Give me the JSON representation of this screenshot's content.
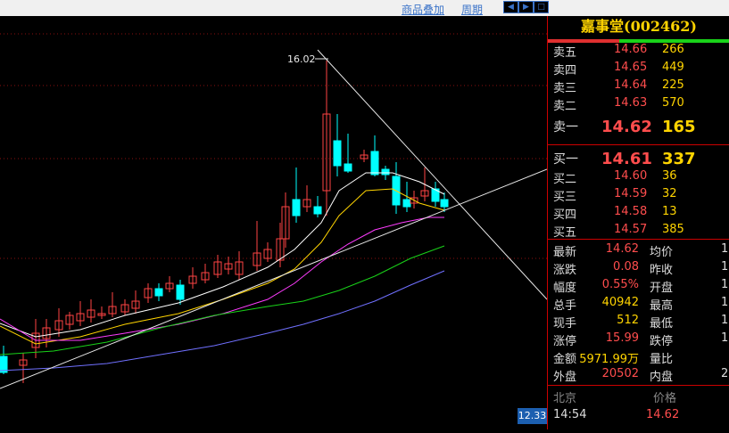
{
  "toolbar": {
    "overlay_label": "商品叠加",
    "period_label": "周期"
  },
  "chart_data": {
    "type": "candlestick",
    "title": "",
    "peak_annotation": "16.02",
    "current_price_tag": "12.33",
    "ma_colors": [
      "#ffffff",
      "#ffd400",
      "#ff3cff",
      "#19d219",
      "#7070ff"
    ],
    "up_color": "#ff4444",
    "down_color": "#00ffff"
  },
  "quote": {
    "title": "嘉事堂(002462)",
    "asks": [
      {
        "label": "卖五",
        "price": "14.66",
        "vol": "266"
      },
      {
        "label": "卖四",
        "price": "14.65",
        "vol": "449"
      },
      {
        "label": "卖三",
        "price": "14.64",
        "vol": "225"
      },
      {
        "label": "卖二",
        "price": "14.63",
        "vol": "570"
      },
      {
        "label": "卖一",
        "price": "14.62",
        "vol": "165"
      }
    ],
    "bids": [
      {
        "label": "买一",
        "price": "14.61",
        "vol": "337"
      },
      {
        "label": "买二",
        "price": "14.60",
        "vol": "36"
      },
      {
        "label": "买三",
        "price": "14.59",
        "vol": "32"
      },
      {
        "label": "买四",
        "price": "14.58",
        "vol": "13"
      },
      {
        "label": "买五",
        "price": "14.57",
        "vol": "385"
      }
    ],
    "stats": [
      {
        "l1": "最新",
        "v1": "14.62",
        "c1": "red",
        "l2": "均价",
        "v2": "1"
      },
      {
        "l1": "涨跌",
        "v1": "0.08",
        "c1": "red",
        "l2": "昨收",
        "v2": "1"
      },
      {
        "l1": "幅度",
        "v1": "0.55%",
        "c1": "red",
        "l2": "开盘",
        "v2": "1"
      },
      {
        "l1": "总手",
        "v1": "40942",
        "c1": "yel",
        "l2": "最高",
        "v2": "1"
      },
      {
        "l1": "现手",
        "v1": "512",
        "c1": "yel",
        "l2": "最低",
        "v2": "1"
      },
      {
        "l1": "涨停",
        "v1": "15.99",
        "c1": "red",
        "l2": "跌停",
        "v2": "1"
      },
      {
        "l1": "金额",
        "v1": "5971.99万",
        "c1": "yel",
        "l2": "量比",
        "v2": ""
      },
      {
        "l1": "外盘",
        "v1": "20502",
        "c1": "red",
        "l2": "内盘",
        "v2": "2"
      }
    ],
    "tick_header": {
      "left": "北京",
      "right": "价格"
    },
    "tick": {
      "time": "14:54",
      "price": "14.62"
    }
  }
}
